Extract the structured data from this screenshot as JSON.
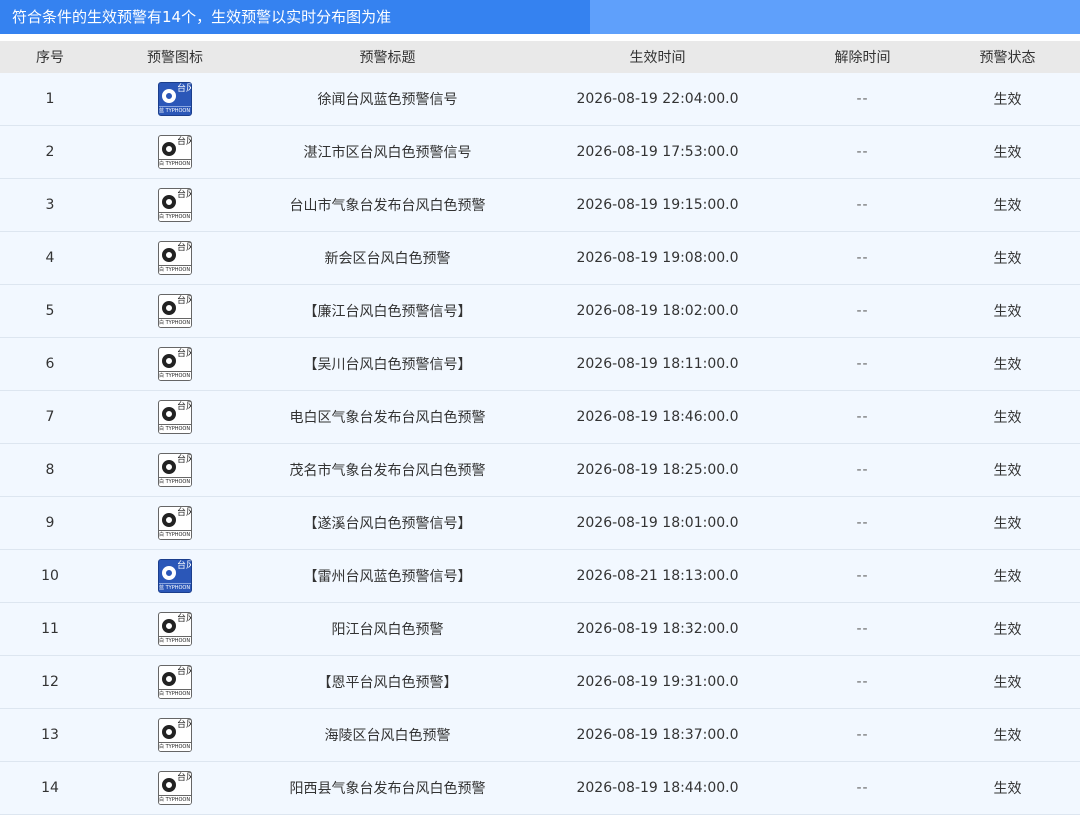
{
  "banner": {
    "text": "符合条件的生效预警有14个，生效预警以实时分布图为准"
  },
  "columns": {
    "seq": "序号",
    "icon": "预警图标",
    "title": "预警标题",
    "effective_time": "生效时间",
    "release_time": "解除时间",
    "status": "预警状态"
  },
  "icon_colors": {
    "blue": "#2b57b8",
    "white": "#ffffff"
  },
  "rows": [
    {
      "seq": "1",
      "icon": "typhoon-blue-icon",
      "sign_char": "台风",
      "sign_color_char": "蓝",
      "sign_en": "TYPHOON",
      "title": "徐闻台风蓝色预警信号",
      "effective_time": "2026-08-19 22:04:00.0",
      "release_time": "--",
      "status": "生效"
    },
    {
      "seq": "2",
      "icon": "typhoon-white-icon",
      "sign_char": "台风",
      "sign_color_char": "白",
      "sign_en": "TYPHOON",
      "title": "湛江市区台风白色预警信号",
      "effective_time": "2026-08-19 17:53:00.0",
      "release_time": "--",
      "status": "生效"
    },
    {
      "seq": "3",
      "icon": "typhoon-white-icon",
      "sign_char": "台风",
      "sign_color_char": "白",
      "sign_en": "TYPHOON",
      "title": "台山市气象台发布台风白色预警",
      "effective_time": "2026-08-19 19:15:00.0",
      "release_time": "--",
      "status": "生效"
    },
    {
      "seq": "4",
      "icon": "typhoon-white-icon",
      "sign_char": "台风",
      "sign_color_char": "白",
      "sign_en": "TYPHOON",
      "title": "新会区台风白色预警",
      "effective_time": "2026-08-19 19:08:00.0",
      "release_time": "--",
      "status": "生效"
    },
    {
      "seq": "5",
      "icon": "typhoon-white-icon",
      "sign_char": "台风",
      "sign_color_char": "白",
      "sign_en": "TYPHOON",
      "title": "【廉江台风白色预警信号】",
      "effective_time": "2026-08-19 18:02:00.0",
      "release_time": "--",
      "status": "生效"
    },
    {
      "seq": "6",
      "icon": "typhoon-white-icon",
      "sign_char": "台风",
      "sign_color_char": "白",
      "sign_en": "TYPHOON",
      "title": "【吴川台风白色预警信号】",
      "effective_time": "2026-08-19 18:11:00.0",
      "release_time": "--",
      "status": "生效"
    },
    {
      "seq": "7",
      "icon": "typhoon-white-icon",
      "sign_char": "台风",
      "sign_color_char": "白",
      "sign_en": "TYPHOON",
      "title": "电白区气象台发布台风白色预警",
      "effective_time": "2026-08-19 18:46:00.0",
      "release_time": "--",
      "status": "生效"
    },
    {
      "seq": "8",
      "icon": "typhoon-white-icon",
      "sign_char": "台风",
      "sign_color_char": "白",
      "sign_en": "TYPHOON",
      "title": "茂名市气象台发布台风白色预警",
      "effective_time": "2026-08-19 18:25:00.0",
      "release_time": "--",
      "status": "生效"
    },
    {
      "seq": "9",
      "icon": "typhoon-white-icon",
      "sign_char": "台风",
      "sign_color_char": "白",
      "sign_en": "TYPHOON",
      "title": "【遂溪台风白色预警信号】",
      "effective_time": "2026-08-19 18:01:00.0",
      "release_time": "--",
      "status": "生效"
    },
    {
      "seq": "10",
      "icon": "typhoon-blue-icon",
      "sign_char": "台风",
      "sign_color_char": "蓝",
      "sign_en": "TYPHOON",
      "title": "【雷州台风蓝色预警信号】",
      "effective_time": "2026-08-21 18:13:00.0",
      "release_time": "--",
      "status": "生效"
    },
    {
      "seq": "11",
      "icon": "typhoon-white-icon",
      "sign_char": "台风",
      "sign_color_char": "白",
      "sign_en": "TYPHOON",
      "title": "阳江台风白色预警",
      "effective_time": "2026-08-19 18:32:00.0",
      "release_time": "--",
      "status": "生效"
    },
    {
      "seq": "12",
      "icon": "typhoon-white-icon",
      "sign_char": "台风",
      "sign_color_char": "白",
      "sign_en": "TYPHOON",
      "title": "【恩平台风白色预警】",
      "effective_time": "2026-08-19 19:31:00.0",
      "release_time": "--",
      "status": "生效"
    },
    {
      "seq": "13",
      "icon": "typhoon-white-icon",
      "sign_char": "台风",
      "sign_color_char": "白",
      "sign_en": "TYPHOON",
      "title": "海陵区台风白色预警",
      "effective_time": "2026-08-19 18:37:00.0",
      "release_time": "--",
      "status": "生效"
    },
    {
      "seq": "14",
      "icon": "typhoon-white-icon",
      "sign_char": "台风",
      "sign_color_char": "白",
      "sign_en": "TYPHOON",
      "title": "阳西县气象台发布台风白色预警",
      "effective_time": "2026-08-19 18:44:00.0",
      "release_time": "--",
      "status": "生效"
    }
  ]
}
